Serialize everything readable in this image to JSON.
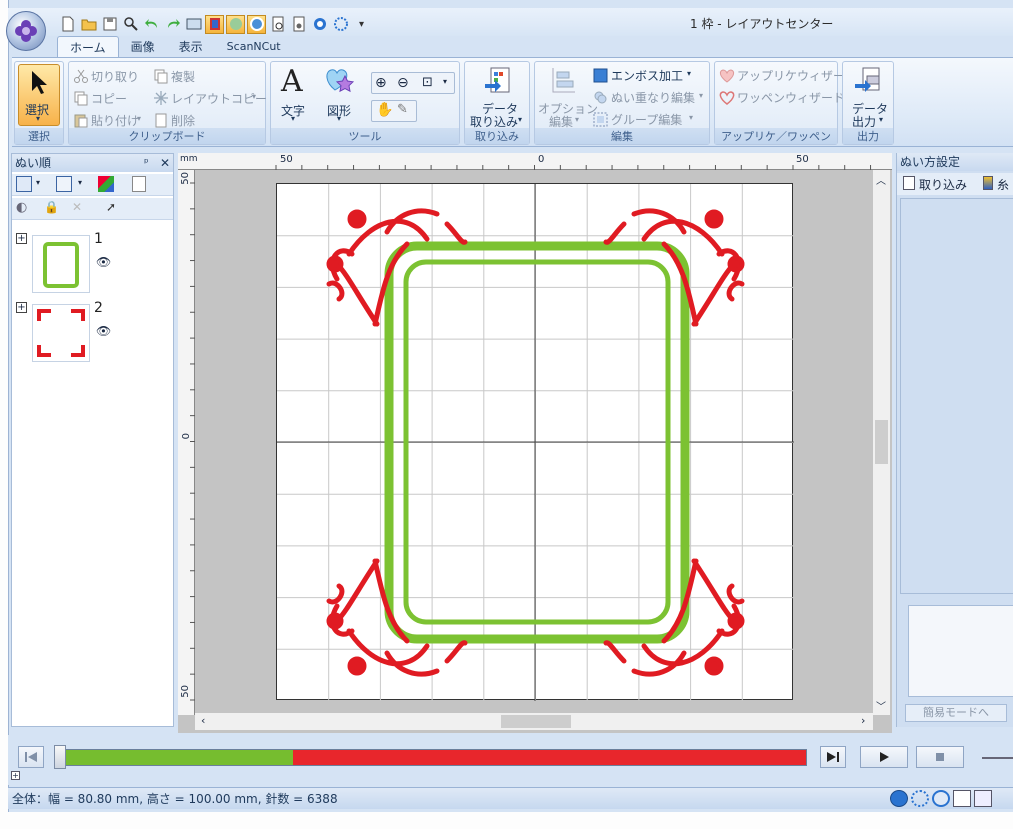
{
  "window": {
    "title": "1 枠 - レイアウトセンター"
  },
  "tabs": [
    {
      "label": "ホーム"
    },
    {
      "label": "画像"
    },
    {
      "label": "表示"
    },
    {
      "label": "ScanNCut"
    }
  ],
  "ribbon": {
    "select": {
      "button": "選択",
      "group": "選択"
    },
    "clipboard": {
      "group": "クリップボード",
      "cut": "切り取り",
      "duplicate": "複製",
      "copy": "コピー",
      "layout_copy": "レイアウトコピー",
      "paste": "貼り付け",
      "delete": "削除"
    },
    "tools": {
      "group": "ツール",
      "text": "文字",
      "shape": "図形"
    },
    "import": {
      "group": "取り込み",
      "button_line1": "データ",
      "button_line2": "取り込み"
    },
    "edit": {
      "group": "編集",
      "options_line1": "オプション",
      "options_line2": "編集",
      "emboss": "エンボス加工",
      "overlap": "ぬい重なり編集",
      "group_edit": "グループ編集"
    },
    "applique": {
      "group": "アップリケ／ワッペン",
      "applique_wizard": "アップリケウィザード",
      "patch_wizard": "ワッペンウィザード"
    },
    "output": {
      "group": "出力",
      "button_line1": "データ",
      "button_line2": "出力"
    }
  },
  "left_panel": {
    "title": "ぬい順",
    "pin": "ᵖ",
    "items": [
      {
        "number": "1"
      },
      {
        "number": "2"
      }
    ]
  },
  "rulers": {
    "h_labels": [
      "50",
      "0",
      "50"
    ],
    "h_unit": "mm",
    "v_labels": [
      "50",
      "0",
      "50"
    ]
  },
  "right_panel": {
    "title": "ぬい方設定",
    "import": "取り込み",
    "thread": "糸",
    "simple_mode": "簡易モードへ"
  },
  "player": {
    "progress_sewn": 0.31,
    "colors": {
      "sewn": "#76bd2f",
      "remaining": "#e8262c"
    }
  },
  "status_bar": {
    "text": "全体：幅 = 80.80 mm, 高さ = 100.00 mm, 針数 = 6388"
  },
  "colors": {
    "frame_green": "#7cc232",
    "flourish_red": "#e01b22",
    "ribbon_bg": "#dde9f7",
    "panel_blue": "#cfdef1"
  }
}
